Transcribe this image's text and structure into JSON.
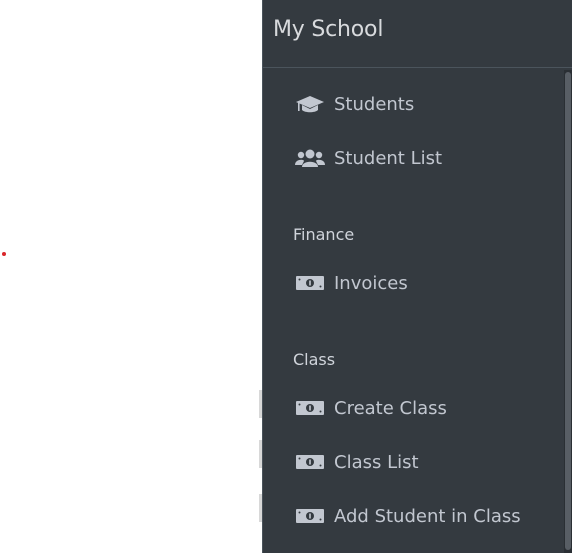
{
  "sidebar": {
    "brand": "My School",
    "items": {
      "students": "Students",
      "student_list": "Student List",
      "invoices": "Invoices",
      "create_class": "Create Class",
      "class_list": "Class List",
      "add_student_in_class": "Add Student in Class"
    },
    "headers": {
      "finance": "Finance",
      "class": "Class"
    },
    "icons": {
      "students": "graduation-cap-icon",
      "student_list": "users-icon",
      "money": "money-bill-icon"
    }
  },
  "colors": {
    "sidebar_bg": "#343a40",
    "text": "#c2c7d0",
    "accent_dot": "#d9262b"
  }
}
